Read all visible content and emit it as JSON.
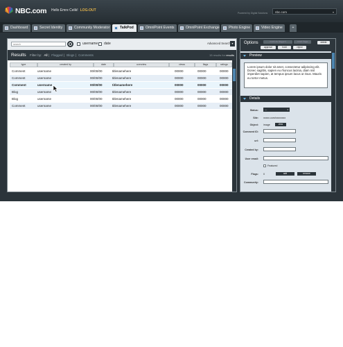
{
  "header": {
    "brand": "NBC.com",
    "greeting": "Hello Emre Celik!",
    "logout": "LOG-OUT",
    "powered": "Powered by Digital Solutions",
    "site_select": "nbc.com"
  },
  "tabs": [
    {
      "label": "Dashboard",
      "active": false
    },
    {
      "label": "Secret Identity",
      "active": false
    },
    {
      "label": "Community Moderator",
      "active": false
    },
    {
      "label": "TalkPod",
      "active": true
    },
    {
      "label": "OmniPoint Events",
      "active": false
    },
    {
      "label": "OmniPoint Exchange",
      "active": false
    },
    {
      "label": "Photo Engine",
      "active": false
    },
    {
      "label": "Video Engine",
      "active": false
    },
    {
      "label": "+",
      "active": false
    }
  ],
  "search": {
    "placeholder": "search",
    "checkbox_username": "username",
    "checkbox_date": "date",
    "advanced": "Advanced Search",
    "advanced_toggle": "▾"
  },
  "results": {
    "title": "Results",
    "filter_label": "Filter by:",
    "filters": [
      "All",
      "Flagged",
      "Blogs",
      "Comments"
    ],
    "count_text": "15 results for",
    "count_em": "results",
    "columns": [
      "type",
      "created by",
      "date",
      "overview",
      "views",
      "flags",
      "ratings"
    ],
    "rows": [
      [
        "Comment",
        "username",
        "00/00/00",
        "titlenamehere",
        "00000",
        "00000",
        "00000"
      ],
      [
        "Comment",
        "username",
        "00/00/00",
        "titlenamehere",
        "00000",
        "00000",
        "00000"
      ],
      [
        "Comment",
        "username",
        "00/00/00",
        "titlenamehere",
        "00000",
        "00000",
        "00000"
      ],
      [
        "Blog",
        "username",
        "00/00/00",
        "titlenamehere",
        "00000",
        "00000",
        "00000"
      ],
      [
        "Blog",
        "username",
        "00/00/00",
        "titlenamehere",
        "00000",
        "00000",
        "00000"
      ],
      [
        "Comment",
        "username",
        "00/00/00",
        "titlenamehere",
        "00000",
        "00000",
        "00000"
      ]
    ],
    "highlighted_row": 2
  },
  "options": {
    "title": "Options",
    "ghost_labels": [
      "mark as flagged",
      "reset flags"
    ],
    "buttons": [
      "approve",
      "hold",
      "reject",
      "delete"
    ]
  },
  "preview": {
    "title": "Preview",
    "text": "Lorem ipsum dolor sit amet, consectetur adipiscing elit. Donec sagittis, sapien eu rhoncus lacinia, diam nisl imperdiet sapien, at tempus ipsum lacus ut risus. Mauris eu tortor metus."
  },
  "details": {
    "title": "Details",
    "status_label": "Status:",
    "status_value": "---",
    "site_label": "Site:",
    "site_value": "xxxxx.com/xxxxxxxx",
    "object_label": "Object:",
    "object_value": "image",
    "object_btn": "view",
    "comment_id_label": "Comment ID:",
    "url_label": "url:",
    "created_by_label": "Created by:",
    "user_email_label": "User email:",
    "featured_label": "Featured",
    "flags_label": "Flags:",
    "flags_value": "0",
    "add_btn": "add",
    "remove_btn": "remove",
    "community_label": "Community:"
  }
}
